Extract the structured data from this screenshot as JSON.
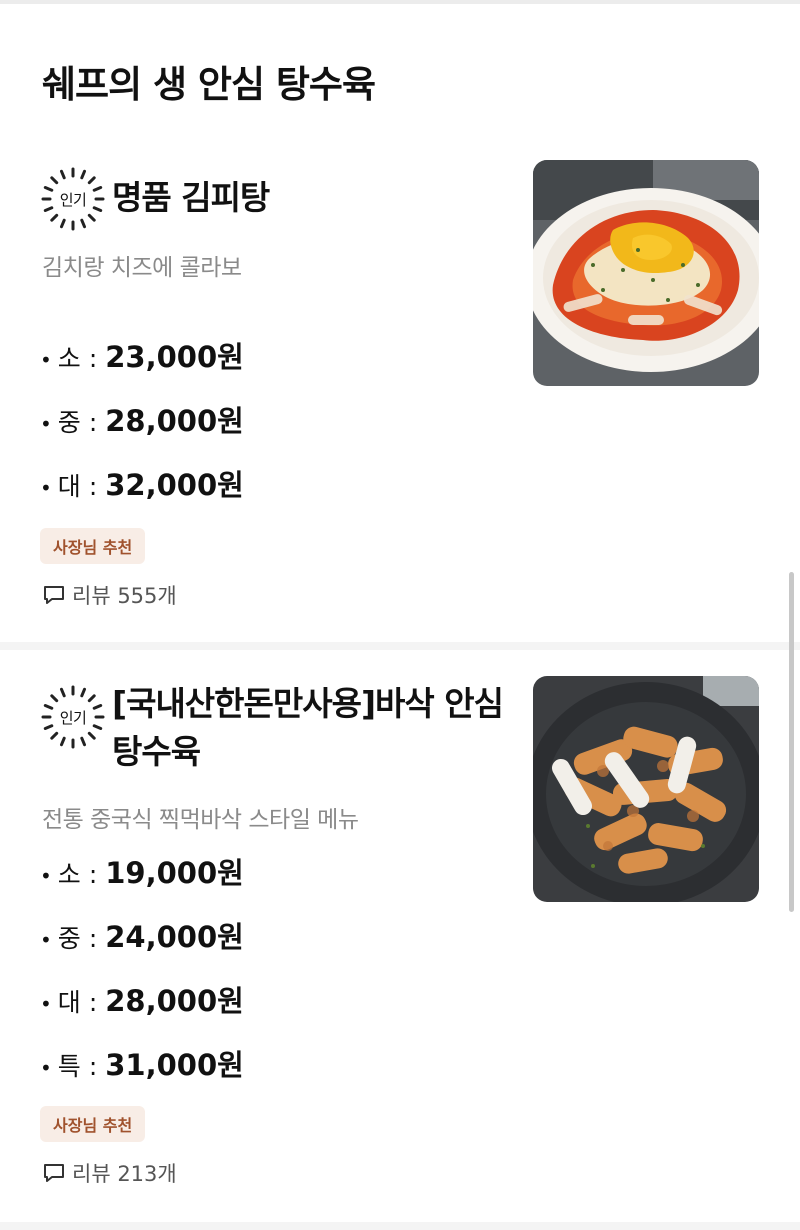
{
  "section": {
    "title": "쉐프의 생 안심 탕수육"
  },
  "items": [
    {
      "badge": "인기",
      "name": "명품 김피탕",
      "description": "김치랑 치즈에 콜라보",
      "prices": [
        {
          "bullet": "•",
          "size": "소",
          "colon": ":",
          "price": "23,000원"
        },
        {
          "bullet": "•",
          "size": "중",
          "colon": ":",
          "price": "28,000원"
        },
        {
          "bullet": "•",
          "size": "대",
          "colon": ":",
          "price": "32,000원"
        }
      ],
      "tag": "사장님 추천",
      "review": "리뷰 555개",
      "image_alt": "cheese-kimchi-tangsuyuk-photo"
    },
    {
      "badge": "인기",
      "name": "[국내산한돈만사용]바삭 안심탕수육",
      "description": "전통 중국식 찍먹바삭 스타일 메뉴",
      "prices": [
        {
          "bullet": "•",
          "size": "소",
          "colon": ":",
          "price": "19,000원"
        },
        {
          "bullet": "•",
          "size": "중",
          "colon": ":",
          "price": "24,000원"
        },
        {
          "bullet": "•",
          "size": "대",
          "colon": ":",
          "price": "28,000원"
        },
        {
          "bullet": "•",
          "size": "특",
          "colon": ":",
          "price": "31,000원"
        }
      ],
      "tag": "사장님 추천",
      "review": "리뷰 213개",
      "image_alt": "crispy-tangsuyuk-photo"
    }
  ],
  "colors": {
    "tag_bg": "#f8ede6",
    "tag_text": "#a0522d",
    "description": "#8a8a8a"
  }
}
